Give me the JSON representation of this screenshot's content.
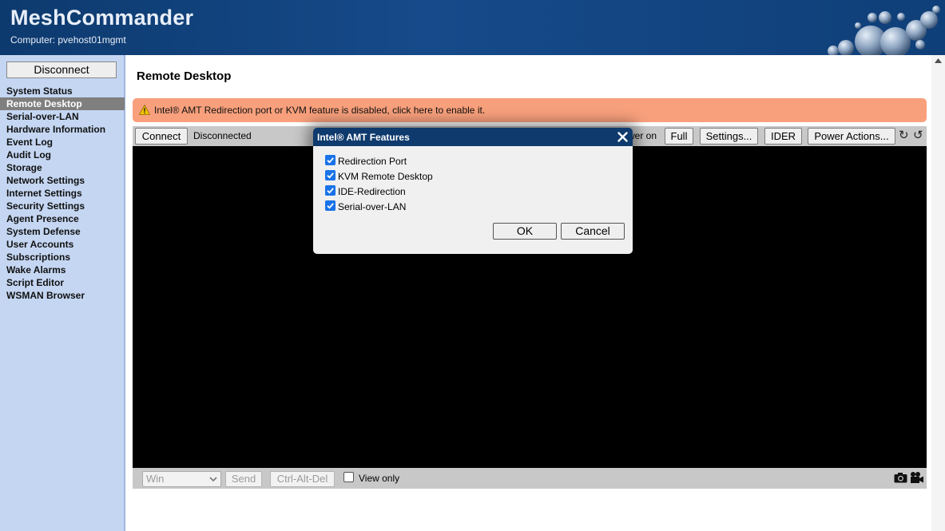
{
  "app": {
    "title": "MeshCommander",
    "computer_label": "Computer: pvehost01mgmt"
  },
  "sidebar": {
    "disconnect_label": "Disconnect",
    "items": [
      {
        "label": "System Status",
        "active": false
      },
      {
        "label": "Remote Desktop",
        "active": true
      },
      {
        "label": "Serial-over-LAN",
        "active": false
      },
      {
        "label": "Hardware Information",
        "active": false
      },
      {
        "label": "Event Log",
        "active": false
      },
      {
        "label": "Audit Log",
        "active": false
      },
      {
        "label": "Storage",
        "active": false
      },
      {
        "label": "Network Settings",
        "active": false
      },
      {
        "label": "Internet Settings",
        "active": false
      },
      {
        "label": "Security Settings",
        "active": false
      },
      {
        "label": "Agent Presence",
        "active": false
      },
      {
        "label": "System Defense",
        "active": false
      },
      {
        "label": "User Accounts",
        "active": false
      },
      {
        "label": "Subscriptions",
        "active": false
      },
      {
        "label": "Wake Alarms",
        "active": false
      },
      {
        "label": "Script Editor",
        "active": false
      },
      {
        "label": "WSMAN Browser",
        "active": false
      }
    ]
  },
  "main": {
    "page_title": "Remote Desktop",
    "warning_text": "Intel® AMT Redirection port or KVM feature is disabled, click here to enable it.",
    "toolbar": {
      "connect_label": "Connect",
      "status": "Disconnected",
      "power_on_partial": "wer on",
      "full_label": "Full",
      "settings_label": "Settings...",
      "ider_label": "IDER",
      "power_actions_label": "Power Actions..."
    },
    "bottom": {
      "key_select_value": "Win",
      "send_label": "Send",
      "cad_label": "Ctrl-Alt-Del",
      "view_only_label": "View only",
      "view_only_checked": false
    }
  },
  "dialog": {
    "title": "Intel® AMT Features",
    "features": [
      {
        "label": "Redirection Port",
        "checked": true
      },
      {
        "label": "KVM Remote Desktop",
        "checked": true
      },
      {
        "label": "IDE-Redirection",
        "checked": true
      },
      {
        "label": "Serial-over-LAN",
        "checked": true
      }
    ],
    "ok_label": "OK",
    "cancel_label": "Cancel"
  },
  "colors": {
    "header_bg": "#164a8a",
    "sidebar_bg": "#c4d6f2",
    "active_item_bg": "#7f7f7f",
    "warning_bg": "#f8a07c",
    "dialog_header_bg": "#0e3a6d",
    "checkbox_accent": "#1a73e8"
  }
}
